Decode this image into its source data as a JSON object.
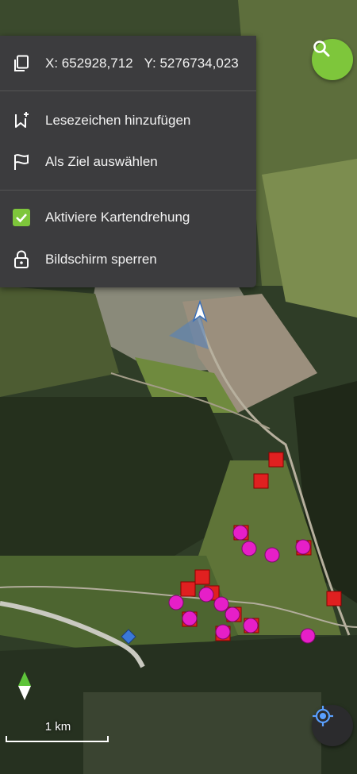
{
  "menu": {
    "coords": {
      "x": "X: 652928,712",
      "y": "Y: 5276734,023"
    },
    "items": [
      {
        "label": "Lesezeichen hinzufügen",
        "icon": "bookmark-add-icon"
      },
      {
        "label": "Als Ziel auswählen",
        "icon": "flag-icon"
      },
      {
        "label": "Aktiviere Kartendrehung",
        "icon": "checkbox-checked-icon",
        "checked": true
      },
      {
        "label": "Bildschirm sperren",
        "icon": "lock-icon"
      }
    ]
  },
  "map": {
    "scale_label": "1 km",
    "colors": {
      "accent": "#7ec63b",
      "square_marker": "#e02020",
      "circle_marker": "#e61fc8",
      "diamond_marker": "#3a78d8",
      "menu_bg": "#3c3c3e"
    }
  }
}
